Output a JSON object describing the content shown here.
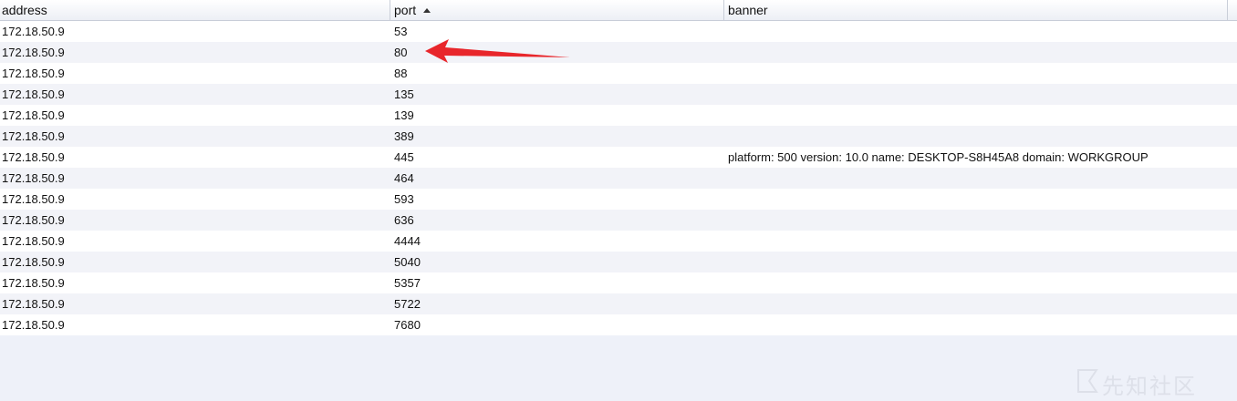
{
  "columns": {
    "address": "address",
    "port": "port",
    "banner": "banner"
  },
  "sort": {
    "column": "port",
    "direction": "ascending"
  },
  "rows": [
    {
      "address": "172.18.50.9",
      "port": "53",
      "banner": ""
    },
    {
      "address": "172.18.50.9",
      "port": "80",
      "banner": ""
    },
    {
      "address": "172.18.50.9",
      "port": "88",
      "banner": ""
    },
    {
      "address": "172.18.50.9",
      "port": "135",
      "banner": ""
    },
    {
      "address": "172.18.50.9",
      "port": "139",
      "banner": ""
    },
    {
      "address": "172.18.50.9",
      "port": "389",
      "banner": ""
    },
    {
      "address": "172.18.50.9",
      "port": "445",
      "banner": "platform: 500 version: 10.0 name: DESKTOP-S8H45A8 domain: WORKGROUP"
    },
    {
      "address": "172.18.50.9",
      "port": "464",
      "banner": ""
    },
    {
      "address": "172.18.50.9",
      "port": "593",
      "banner": ""
    },
    {
      "address": "172.18.50.9",
      "port": "636",
      "banner": ""
    },
    {
      "address": "172.18.50.9",
      "port": "4444",
      "banner": ""
    },
    {
      "address": "172.18.50.9",
      "port": "5040",
      "banner": ""
    },
    {
      "address": "172.18.50.9",
      "port": "5357",
      "banner": ""
    },
    {
      "address": "172.18.50.9",
      "port": "5722",
      "banner": ""
    },
    {
      "address": "172.18.50.9",
      "port": "7680",
      "banner": ""
    }
  ],
  "annotation": {
    "color": "#e8262b",
    "icon": "red-arrow-icon",
    "target_port": "80"
  },
  "watermark": {
    "text": "先知社区",
    "icon": "watermark-logo-icon"
  }
}
